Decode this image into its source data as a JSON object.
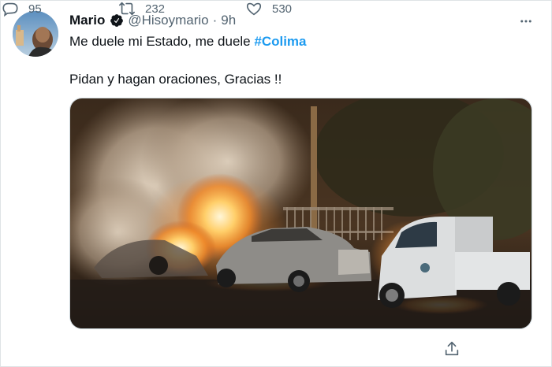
{
  "tweet": {
    "author_name": "Mario",
    "handle": "@Hisoymario",
    "separator": "·",
    "time": "9h",
    "line1_text": "Me duele mi Estado, me duele ",
    "hashtag": "#Colima",
    "line2_text": "Pidan y hagan oraciones, Gracias !!"
  },
  "actions": {
    "replies": "95",
    "retweets": "232",
    "likes": "530"
  },
  "icons": {
    "verified": "verified-badge-icon",
    "more": "more-options-icon",
    "reply": "reply-icon",
    "retweet": "retweet-icon",
    "like": "heart-icon",
    "share": "share-icon"
  },
  "colors": {
    "accent": "#1d9bf0",
    "secondary_text": "#536471",
    "primary_text": "#0f1419"
  }
}
